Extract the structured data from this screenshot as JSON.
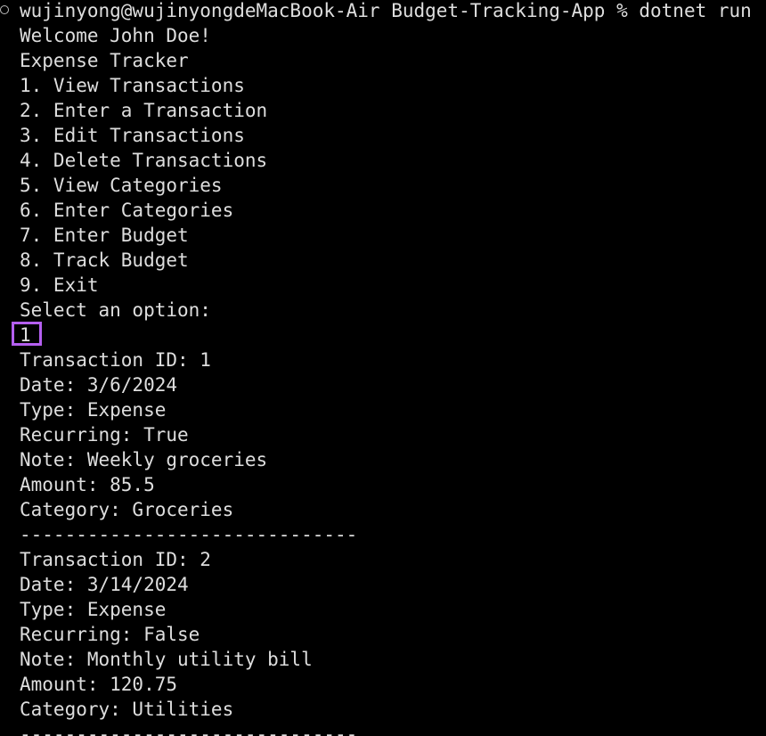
{
  "terminal": {
    "prompt_line": "wujinyong@wujinyongdeMacBook-Air Budget-Tracking-App % dotnet run",
    "welcome": "Welcome John Doe!",
    "app_title": "Expense Tracker",
    "menu": [
      "1. View Transactions",
      "2. Enter a Transaction",
      "3. Edit Transactions",
      "4. Delete Transactions",
      "5. View Categories",
      "6. Enter Categories",
      "7. Enter Budget",
      "8. Track Budget",
      "9. Exit"
    ],
    "select_prompt": "Select an option:",
    "user_input": "1",
    "transactions": [
      {
        "id": "Transaction ID: 1",
        "date": "Date: 3/6/2024",
        "type": "Type: Expense",
        "recurring": "Recurring: True",
        "note": "Note: Weekly groceries",
        "amount": "Amount: 85.5",
        "category": "Category: Groceries"
      },
      {
        "id": "Transaction ID: 2",
        "date": "Date: 3/14/2024",
        "type": "Type: Expense",
        "recurring": "Recurring: False",
        "note": "Note: Monthly utility bill",
        "amount": "Amount: 120.75",
        "category": "Category: Utilities"
      }
    ],
    "separator": "------------------------------",
    "colors": {
      "background": "#000000",
      "text": "#dedede",
      "input_highlight": "#b45ff0"
    }
  }
}
